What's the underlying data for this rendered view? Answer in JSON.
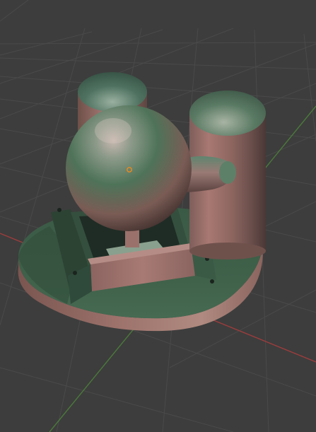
{
  "viewport": {
    "background_color": "#3d3d3d",
    "grid_color": "#4d4d4d",
    "x_axis_color": "#9e3c3c",
    "y_axis_color": "#4b7a3a",
    "origin_marker_color": "#f08a1c",
    "model_colors": {
      "green": "#3d6048",
      "copper": "#9a6b64",
      "dark": "#22322a",
      "highlight": "#cfc0b8"
    }
  }
}
